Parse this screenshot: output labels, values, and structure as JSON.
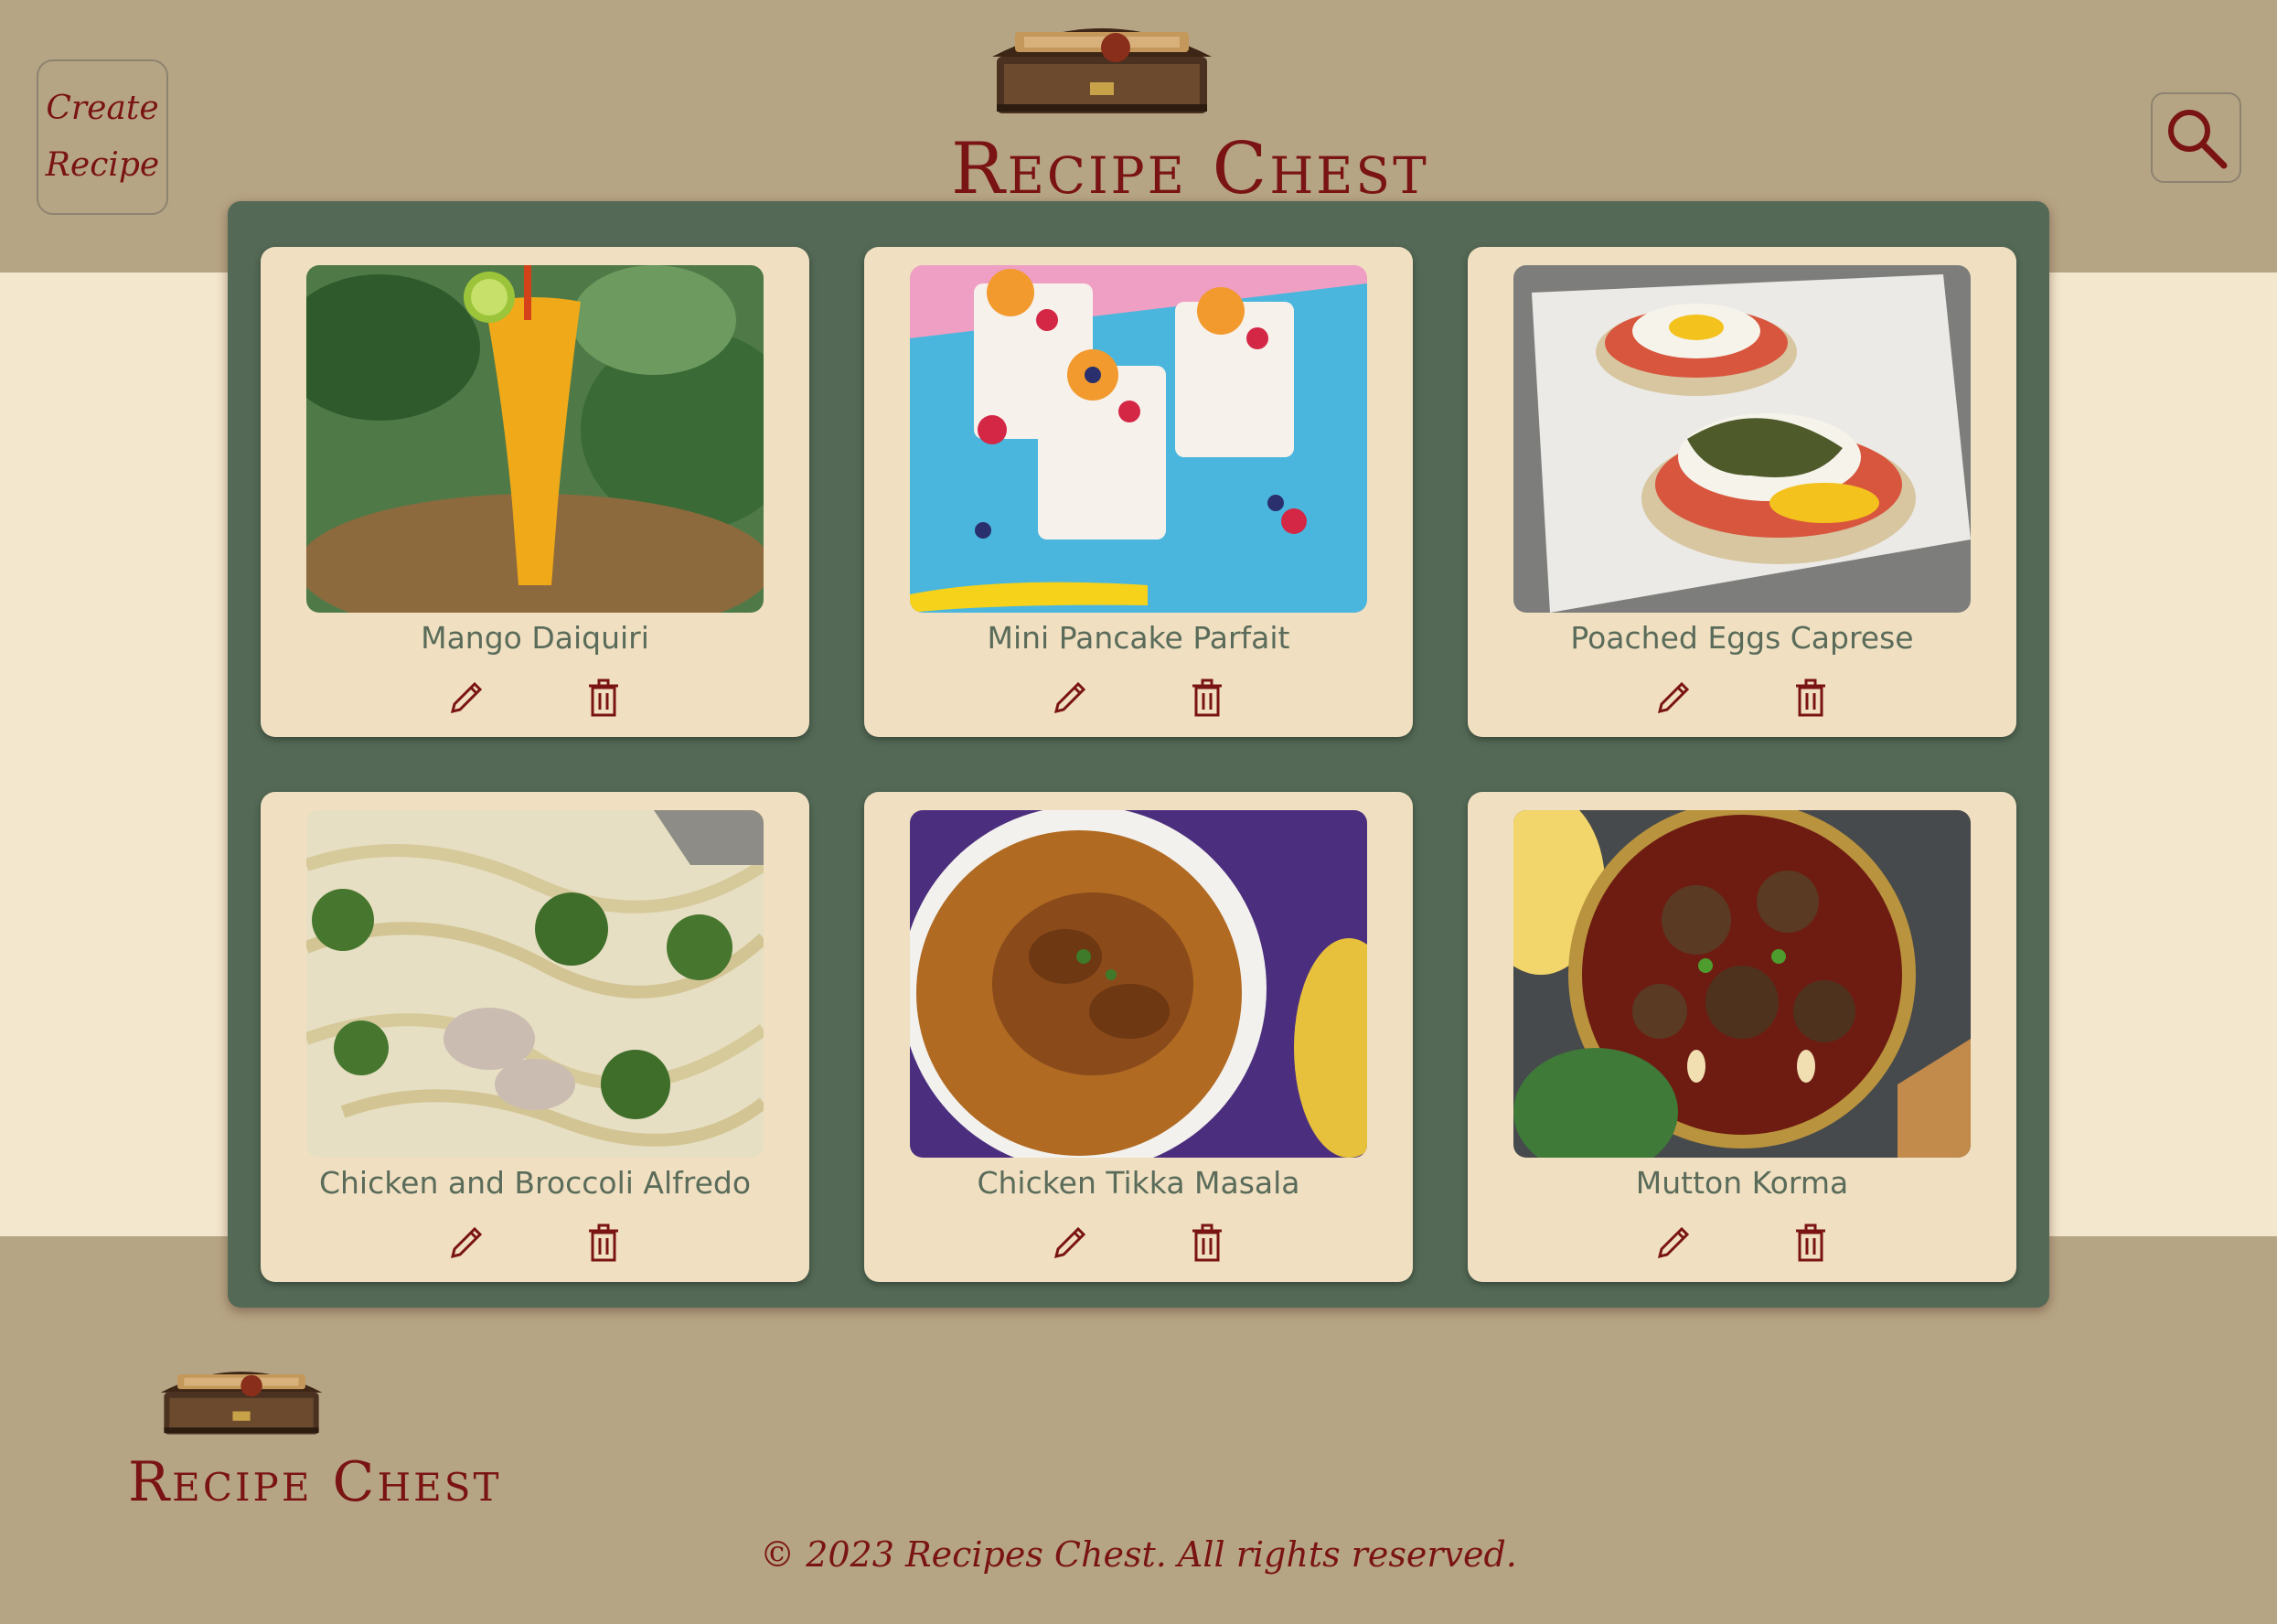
{
  "header": {
    "create_label_line1": "Create",
    "create_label_line2": "Recipe",
    "brand_title": "Recipe Chest"
  },
  "recipes": [
    {
      "title": "Mango Daiquiri"
    },
    {
      "title": "Mini Pancake Parfait"
    },
    {
      "title": "Poached Eggs Caprese"
    },
    {
      "title": "Chicken and Broccoli Alfredo"
    },
    {
      "title": "Chicken Tikka Masala"
    },
    {
      "title": "Mutton Korma"
    }
  ],
  "footer": {
    "brand_title": "Recipe Chest",
    "copyright": "© 2023 Recipes Chest. All rights reserved."
  },
  "icons": {
    "create": "none",
    "search": "search-icon",
    "edit": "pencil-icon",
    "delete": "trash-icon",
    "logo": "treasure-chest-icon"
  },
  "colors": {
    "header_bg": "#b6a584",
    "page_bg": "#f3e7cd",
    "board_bg": "#546a56",
    "card_bg": "#f0e0c1",
    "accent": "#7a1414",
    "title_text": "#5a6b5a"
  }
}
